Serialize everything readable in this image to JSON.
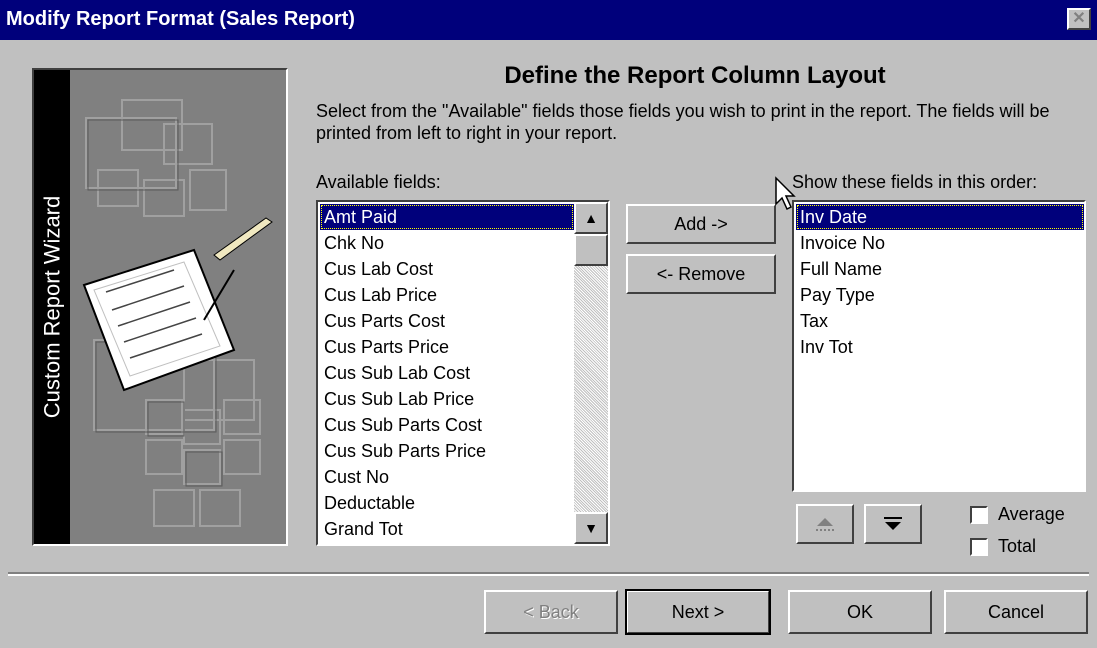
{
  "window": {
    "title": "Modify Report Format (Sales Report)",
    "close_icon": "close-icon"
  },
  "wizard_panel": {
    "side_label": "Custom Report Wizard",
    "illustration": "report-wizard-graphic"
  },
  "page": {
    "heading": "Define the Report Column Layout",
    "description": "Select from the \"Available\" fields those fields you wish to print in the report. The fields will be printed from left to right in your report."
  },
  "available": {
    "label": "Available fields:",
    "items": [
      "Amt Paid",
      "Chk No",
      "Cus Lab Cost",
      "Cus Lab Price",
      "Cus Parts Cost",
      "Cus Parts Price",
      "Cus Sub Lab Cost",
      "Cus Sub Lab Price",
      "Cus Sub Parts Cost",
      "Cus Sub Parts Price",
      "Cust No",
      "Deductable",
      "Grand Tot"
    ],
    "selected": "Amt Paid"
  },
  "selected_fields": {
    "label": "Show these fields in this order:",
    "items": [
      "Inv Date",
      "Invoice No",
      "Full Name",
      "Pay Type",
      "Tax",
      "Inv Tot"
    ],
    "selected": "Inv Date"
  },
  "buttons": {
    "add": "Add ->",
    "remove": "<- Remove",
    "move_up_icon": "arrow-up-icon",
    "move_down_icon": "arrow-down-icon",
    "back": "< Back",
    "next": "Next >",
    "ok": "OK",
    "cancel": "Cancel"
  },
  "options": {
    "average": {
      "label": "Average",
      "checked": false
    },
    "total": {
      "label": "Total",
      "checked": false
    }
  },
  "colors": {
    "titlebar": "#00007b",
    "face": "#c0c0c0",
    "selection": "#00007b"
  }
}
